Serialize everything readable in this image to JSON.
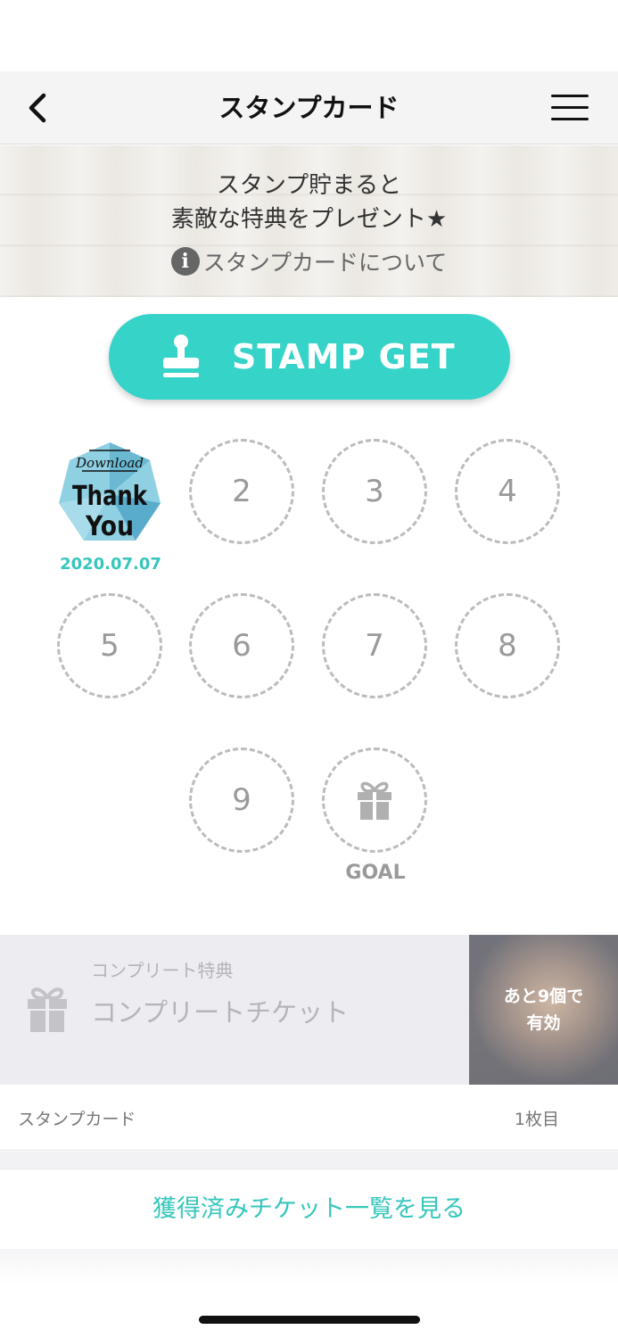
{
  "header": {
    "title": "スタンプカード"
  },
  "banner": {
    "line1": "スタンプ貯まると",
    "line2": "素敵な特典をプレゼント★",
    "info_label": "スタンプカードについて"
  },
  "stamp_button": {
    "label": "STAMP GET"
  },
  "stamp_card": {
    "stamped": {
      "line1": "Download",
      "line2": "Thank",
      "line3": "You",
      "date": "2020.07.07"
    },
    "slots": [
      "2",
      "3",
      "4",
      "5",
      "6",
      "7",
      "8",
      "9"
    ],
    "goal_label": "GOAL"
  },
  "reward": {
    "subtitle": "コンプリート特典",
    "title": "コンプリートチケット",
    "remaining_line1": "あと9個で",
    "remaining_line2": "有効"
  },
  "card_info": {
    "label": "スタンプカード",
    "count": "1枚目"
  },
  "tickets_link": "獲得済みチケット一覧を見る",
  "colors": {
    "accent": "#36d3c8",
    "accent_text": "#36c6bb",
    "slot_border": "#bcbcbc"
  },
  "icons": [
    "back-chevron-icon",
    "hamburger-menu-icon",
    "info-icon",
    "stamp-icon",
    "gift-icon"
  ]
}
